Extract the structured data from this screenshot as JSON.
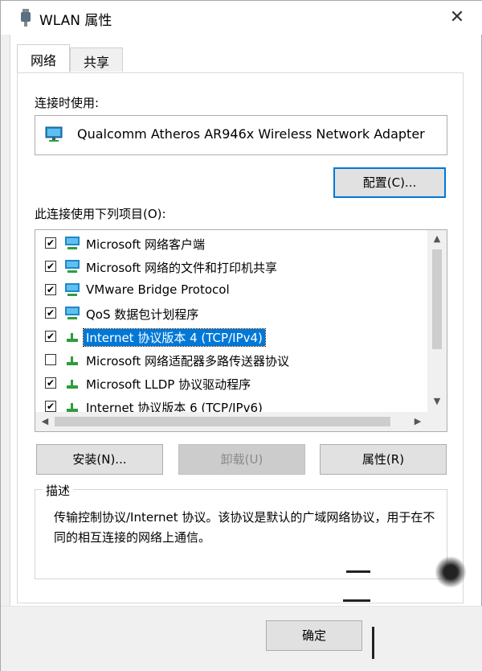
{
  "window": {
    "title": "WLAN 属性",
    "close_glyph": "✕"
  },
  "tabs": [
    {
      "label": "网络"
    },
    {
      "label": "共享"
    }
  ],
  "connect_using": {
    "label": "连接时使用:",
    "adapter": "Qualcomm Atheros AR946x Wireless Network Adapter"
  },
  "configure_button": "配置(C)...",
  "items_label": "此连接使用下列项目(O):",
  "items": [
    {
      "label": "Microsoft 网络客户端",
      "checked": true,
      "icon": "network-monitor-icon"
    },
    {
      "label": "Microsoft 网络的文件和打印机共享",
      "checked": true,
      "icon": "network-monitor-icon"
    },
    {
      "label": "VMware Bridge Protocol",
      "checked": true,
      "icon": "network-monitor-icon"
    },
    {
      "label": "QoS 数据包计划程序",
      "checked": true,
      "icon": "network-monitor-icon"
    },
    {
      "label": "Internet 协议版本 4 (TCP/IPv4)",
      "checked": true,
      "selected": true,
      "icon": "protocol-icon"
    },
    {
      "label": "Microsoft 网络适配器多路传送器协议",
      "checked": false,
      "icon": "protocol-icon"
    },
    {
      "label": "Microsoft LLDP 协议驱动程序",
      "checked": true,
      "icon": "protocol-icon"
    },
    {
      "label": "Internet 协议版本 6 (TCP/IPv6)",
      "checked": true,
      "icon": "protocol-icon"
    }
  ],
  "buttons": {
    "install": "安装(N)...",
    "uninstall": "卸载(U)",
    "properties": "属性(R)",
    "ok": "确定"
  },
  "description": {
    "title": "描述",
    "text": "传输控制协议/Internet 协议。该协议是默认的广域网络协议，用于在不同的相互连接的网络上通信。"
  },
  "colors": {
    "accent": "#0078d7",
    "network_icon": "#1e88c8",
    "protocol_icon": "#2e9d3e"
  }
}
